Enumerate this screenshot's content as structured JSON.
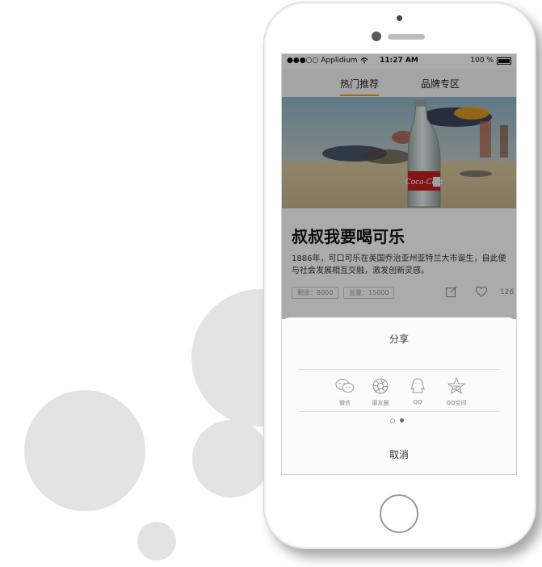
{
  "status_bar": {
    "carrier": "Applidium",
    "time": "11:27 AM",
    "battery": "100 %"
  },
  "tabs": [
    {
      "label": "热门推荐",
      "active": true
    },
    {
      "label": "品牌专区",
      "active": false
    }
  ],
  "card": {
    "title": "叔叔我要喝可乐",
    "description": "1886年，可口可乐在美国乔治亚州亚特兰大市诞生，自此便与社会发展相互交融，激发创新灵感。",
    "remaining": "剩余：8000",
    "total": "总量：15000",
    "likes": "126",
    "bottle_label": "Coca-Cola"
  },
  "share_sheet": {
    "title": "分享",
    "items": [
      {
        "label": "微信",
        "icon": "wechat-icon"
      },
      {
        "label": "朋友圈",
        "icon": "moments-icon"
      },
      {
        "label": "QQ",
        "icon": "qq-icon"
      },
      {
        "label": "QQ空间",
        "icon": "qzone-icon"
      }
    ],
    "page_count": 2,
    "active_page": 2,
    "cancel": "取消"
  },
  "colors": {
    "accent": "#f2a100",
    "bubble": "#e3e3e3",
    "coke_red": "#c41e24"
  }
}
